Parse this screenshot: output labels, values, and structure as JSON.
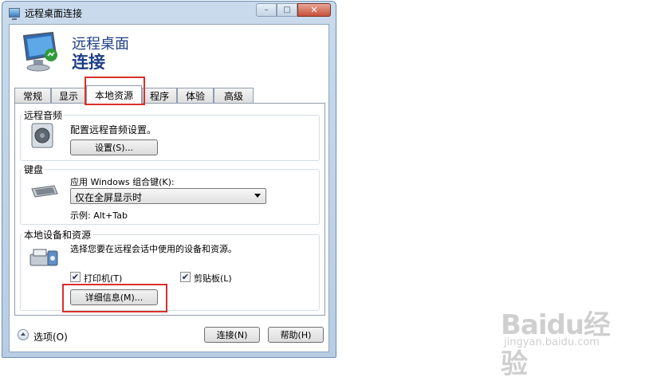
{
  "window": {
    "title": "远程桌面连接",
    "controls": {
      "minimize": "–",
      "maximize": "□",
      "close": "✕"
    }
  },
  "header": {
    "line1": "远程桌面",
    "line2": "连接"
  },
  "tabs": [
    {
      "label": "常规"
    },
    {
      "label": "显示"
    },
    {
      "label": "本地资源",
      "active": true
    },
    {
      "label": "程序"
    },
    {
      "label": "体验"
    },
    {
      "label": "高级"
    }
  ],
  "audio": {
    "title": "远程音频",
    "desc": "配置远程音频设置。",
    "button": "设置(S)..."
  },
  "keyboard": {
    "title": "键盘",
    "desc": "应用 Windows 组合键(K):",
    "select_value": "仅在全屏显示时",
    "example": "示例: Alt+Tab"
  },
  "devices": {
    "title": "本地设备和资源",
    "desc": "选择您要在远程会话中使用的设备和资源。",
    "printer": {
      "label": "打印机(T)",
      "checked": true
    },
    "clipboard": {
      "label": "剪贴板(L)",
      "checked": true
    },
    "details_button": "详细信息(M)..."
  },
  "footer": {
    "options": "选项(O)",
    "connect": "连接(N)",
    "help": "帮助(H)"
  },
  "watermark": {
    "brand": "Baidu经验",
    "url": "jingyan.baidu.com"
  },
  "colors": {
    "accent": "#1e3f86",
    "highlight": "#d9302b",
    "titlebar": "#c9daec"
  }
}
